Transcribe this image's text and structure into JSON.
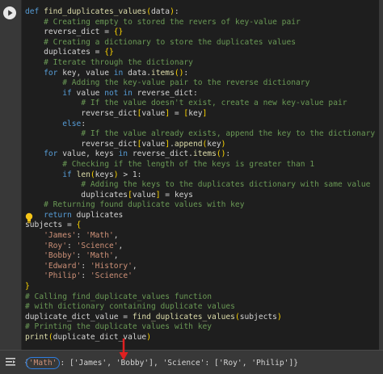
{
  "code_lines": [
    [
      [
        "k",
        "def "
      ],
      [
        "f",
        "find_duplicates_values"
      ],
      [
        "bl",
        "("
      ],
      [
        "p",
        "data"
      ],
      [
        "bl",
        ")"
      ],
      [
        "p",
        ":"
      ]
    ],
    [
      [
        "p",
        "    "
      ],
      [
        "c",
        "# Creating empty to stored the revers of key-value pair"
      ]
    ],
    [
      [
        "p",
        "    reverse_dict = "
      ],
      [
        "bl",
        "{}"
      ]
    ],
    [
      [
        "p",
        "    "
      ],
      [
        "c",
        "# Creating a dictionary to store the duplicates values"
      ]
    ],
    [
      [
        "p",
        "    duplicates = "
      ],
      [
        "bl",
        "{}"
      ]
    ],
    [
      [
        "p",
        "    "
      ],
      [
        "c",
        "# Iterate through the dictionary"
      ]
    ],
    [
      [
        "p",
        "    "
      ],
      [
        "k",
        "for"
      ],
      [
        "p",
        " key, value "
      ],
      [
        "k",
        "in"
      ],
      [
        "p",
        " data."
      ],
      [
        "f",
        "items"
      ],
      [
        "bl",
        "()"
      ],
      [
        "p",
        ":"
      ]
    ],
    [
      [
        "p",
        "        "
      ],
      [
        "c",
        "# Adding the key-value pair to the reverse dictionary"
      ]
    ],
    [
      [
        "p",
        "        "
      ],
      [
        "k",
        "if"
      ],
      [
        "p",
        " value "
      ],
      [
        "k",
        "not in"
      ],
      [
        "p",
        " reverse_dict:"
      ]
    ],
    [
      [
        "p",
        "            "
      ],
      [
        "c",
        "# If the value doesn't exist, create a new key-value pair"
      ]
    ],
    [
      [
        "p",
        "            reverse_dict"
      ],
      [
        "bl",
        "["
      ],
      [
        "p",
        "value"
      ],
      [
        "bl",
        "]"
      ],
      [
        "p",
        " = "
      ],
      [
        "bl",
        "["
      ],
      [
        "p",
        "key"
      ],
      [
        "bl",
        "]"
      ]
    ],
    [
      [
        "p",
        "        "
      ],
      [
        "k",
        "else"
      ],
      [
        "p",
        ":"
      ]
    ],
    [
      [
        "p",
        "            "
      ],
      [
        "c",
        "# If the value already exists, append the key to the dictionary"
      ]
    ],
    [
      [
        "p",
        "            reverse_dict"
      ],
      [
        "bl",
        "["
      ],
      [
        "p",
        "value"
      ],
      [
        "bl",
        "]"
      ],
      [
        "p",
        "."
      ],
      [
        "f",
        "append"
      ],
      [
        "bl",
        "("
      ],
      [
        "p",
        "key"
      ],
      [
        "bl",
        ")"
      ]
    ],
    [
      [
        "p",
        "    "
      ],
      [
        "k",
        "for"
      ],
      [
        "p",
        " value, keys "
      ],
      [
        "k",
        "in"
      ],
      [
        "p",
        " reverse_dict."
      ],
      [
        "f",
        "items"
      ],
      [
        "bl",
        "()"
      ],
      [
        "p",
        ":"
      ]
    ],
    [
      [
        "p",
        "        "
      ],
      [
        "c",
        "# Checking if the length of the keys is greater than 1"
      ]
    ],
    [
      [
        "p",
        "        "
      ],
      [
        "k",
        "if"
      ],
      [
        "p",
        " "
      ],
      [
        "f",
        "len"
      ],
      [
        "bl",
        "("
      ],
      [
        "p",
        "keys"
      ],
      [
        "bl",
        ")"
      ],
      [
        "p",
        " > 1:"
      ]
    ],
    [
      [
        "p",
        "            "
      ],
      [
        "c",
        "# Adding the keys to the duplicates dictionary with same value"
      ]
    ],
    [
      [
        "p",
        "            duplicates"
      ],
      [
        "bl",
        "["
      ],
      [
        "p",
        "value"
      ],
      [
        "bl",
        "]"
      ],
      [
        "p",
        " = keys"
      ]
    ],
    [
      [
        "p",
        "    "
      ],
      [
        "c",
        "# Returning found duplicate values with key"
      ]
    ],
    [
      [
        "p",
        "    "
      ],
      [
        "k",
        "return"
      ],
      [
        "p",
        " duplicates"
      ]
    ],
    [
      [
        "p",
        "subjects = "
      ],
      [
        "bl",
        "{"
      ]
    ],
    [
      [
        "p",
        "    "
      ],
      [
        "s",
        "'James'"
      ],
      [
        "p",
        ": "
      ],
      [
        "s",
        "'Math'"
      ],
      [
        "p",
        ","
      ]
    ],
    [
      [
        "p",
        "    "
      ],
      [
        "s",
        "'Roy'"
      ],
      [
        "p",
        ": "
      ],
      [
        "s",
        "'Science'"
      ],
      [
        "p",
        ","
      ]
    ],
    [
      [
        "p",
        "    "
      ],
      [
        "s",
        "'Bobby'"
      ],
      [
        "p",
        ": "
      ],
      [
        "s",
        "'Math'"
      ],
      [
        "p",
        ","
      ]
    ],
    [
      [
        "p",
        "    "
      ],
      [
        "s",
        "'Edward'"
      ],
      [
        "p",
        ": "
      ],
      [
        "s",
        "'History'"
      ],
      [
        "p",
        ","
      ]
    ],
    [
      [
        "p",
        "    "
      ],
      [
        "s",
        "'Philip'"
      ],
      [
        "p",
        ": "
      ],
      [
        "s",
        "'Science'"
      ]
    ],
    [
      [
        "bl",
        "}"
      ]
    ],
    [
      [
        "c",
        "# Calling find_duplicate_values function"
      ]
    ],
    [
      [
        "c",
        "# with dictionary containing duplicate values"
      ]
    ],
    [
      [
        "p",
        "duplicate_dict_value = "
      ],
      [
        "f",
        "find_duplicates_values"
      ],
      [
        "bl",
        "("
      ],
      [
        "p",
        "subjects"
      ],
      [
        "bl",
        ")"
      ]
    ],
    [
      [
        "c",
        "# Printing the duplicate values with key"
      ]
    ],
    [
      [
        "f",
        "print"
      ],
      [
        "bl",
        "("
      ],
      [
        "p",
        "duplicate_dict_value"
      ],
      [
        "bl",
        ")"
      ]
    ]
  ],
  "output": {
    "prefix": "{",
    "key": "'Math'",
    "rest": ": ['James', 'Bobby'], 'Science': ['Roy', 'Philip']}"
  },
  "icons": {
    "run": "play-icon",
    "hint": "lightbulb-icon",
    "output": "output-menu-icon",
    "annotation": "red-arrow-icon"
  },
  "colors": {
    "keyword": "#569cd6",
    "comment": "#6a9955",
    "string": "#ce9178",
    "function": "#dcdcaa",
    "bracket": "#ffd700",
    "highlight_circle": "#2e7de0",
    "arrow": "#e02020"
  }
}
